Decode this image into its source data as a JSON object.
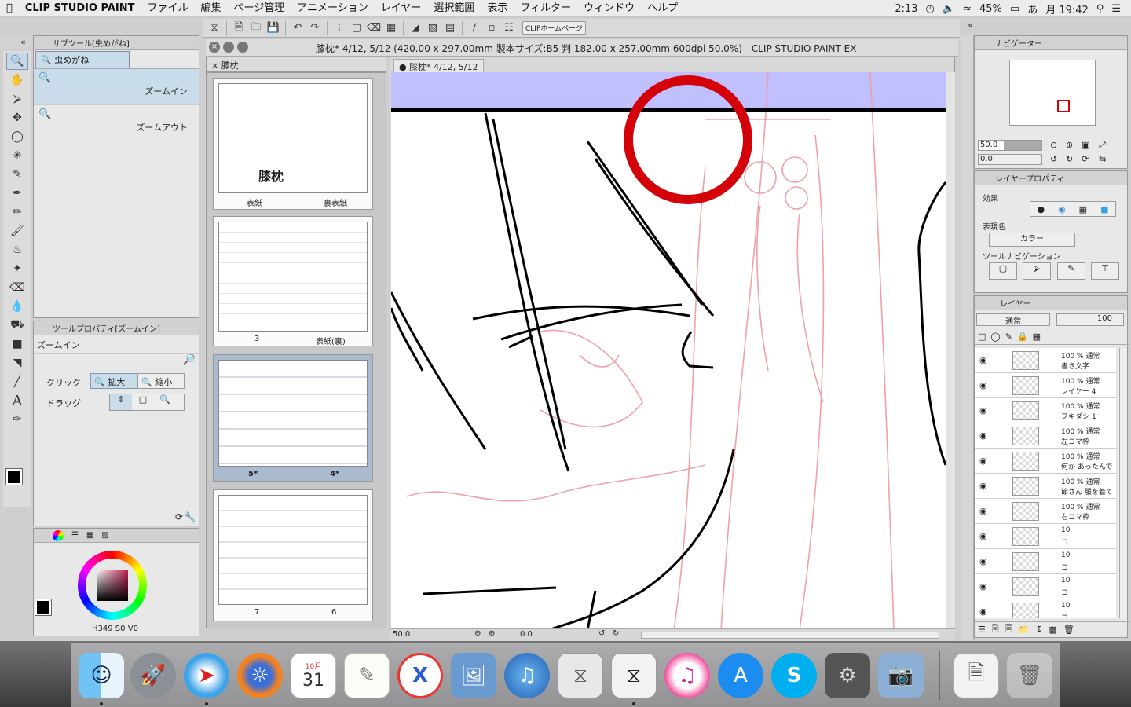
{
  "menubar": {
    "apple_icon": "apple-icon",
    "app_name": "CLIP STUDIO PAINT",
    "items": [
      "ファイル",
      "編集",
      "ページ管理",
      "アニメーション",
      "レイヤー",
      "選択範囲",
      "表示",
      "フィルター",
      "ウィンドウ",
      "ヘルプ"
    ],
    "status": {
      "time_left": "2:13",
      "battery": "45%",
      "ime": "あ",
      "clock": "月 19:42"
    }
  },
  "toolbar": {
    "home_button": "CLIPホームページ"
  },
  "window": {
    "title": "膝枕* 4/12, 5/12 (420.00 x 297.00mm 製本サイズ:B5 判 182.00 x 257.00mm 600dpi 50.0%)  - CLIP STUDIO PAINT EX"
  },
  "subtool": {
    "header": "サブツール[虫めがね]",
    "group_tab": "虫めがね",
    "items": [
      "ズームイン",
      "ズームアウト"
    ]
  },
  "toolprop": {
    "header": "ツールプロパティ[ズームイン]",
    "name": "ズームイン",
    "click_label": "クリック",
    "drag_label": "ドラッグ",
    "zoom_in": "拡大",
    "zoom_out": "縮小"
  },
  "color": {
    "h": "349",
    "s": "0",
    "v": "0",
    "main": "#000000",
    "sub": "#ffffff"
  },
  "pages": {
    "tab": "膝枕",
    "cards": [
      {
        "left": "表紙",
        "right": "裏表紙",
        "cover_text": "膝枕"
      },
      {
        "left": "3",
        "right": "表紙(裏)"
      },
      {
        "left": "5*",
        "right": "4*"
      },
      {
        "left": "7",
        "right": "6"
      }
    ]
  },
  "doc_tab": "膝枕* 4/12, 5/12",
  "status": {
    "zoom": "50.0",
    "angle": "0.0"
  },
  "navigator": {
    "header": "ナビゲーター",
    "zoom": "50.0",
    "rotate": "0.0"
  },
  "layerprop": {
    "header": "レイヤープロパティ",
    "effect_label": "効果",
    "color_label": "表現色",
    "color_value": "カラー",
    "toolnav_label": "ツールナビゲーション"
  },
  "layers": {
    "header": "レイヤー",
    "blend": "通常",
    "opacity": "100",
    "rows": [
      {
        "mode": "100 % 通常",
        "name": "書き文字"
      },
      {
        "mode": "100 % 通常",
        "name": "レイヤー 4"
      },
      {
        "mode": "100 % 通常",
        "name": "フキダシ 1"
      },
      {
        "mode": "100 % 通常",
        "name": "左コマ枠"
      },
      {
        "mode": "100 % 通常",
        "name": "何か あったんです"
      },
      {
        "mode": "100 % 通常",
        "name": "節さん 服を着て"
      },
      {
        "mode": "100 % 通常",
        "name": "右コマ枠"
      },
      {
        "mode": "10",
        "name": "コ"
      },
      {
        "mode": "10",
        "name": "コ"
      },
      {
        "mode": "10",
        "name": "コ"
      },
      {
        "mode": "10",
        "name": "コ"
      }
    ]
  },
  "dock": {
    "calendar_month": "10月",
    "calendar_day": "31",
    "apps": [
      "finder-icon",
      "launchpad-icon",
      "safari-icon",
      "firefox-icon",
      "calendar-icon",
      "textedit-icon",
      "x-app-icon",
      "preview-icon",
      "itunes-helper-icon",
      "clip-icon",
      "clip-studio-icon",
      "itunes-icon",
      "app-store-icon",
      "skype-icon",
      "system-preferences-icon",
      "image-capture-icon",
      "document-icon",
      "trash-icon"
    ]
  },
  "colors": {
    "highlight_circle": "#d4000a",
    "band": "#c0c0ff",
    "sketch": "#f0a0a8"
  }
}
